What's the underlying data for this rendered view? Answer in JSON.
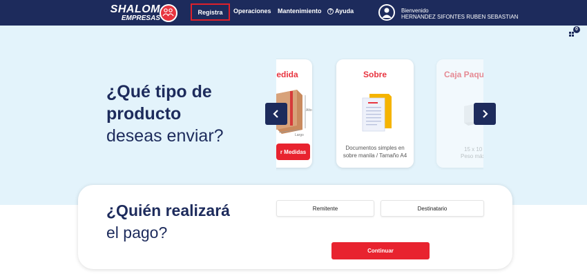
{
  "brand": {
    "name": "SHALOM",
    "sub": "EMPRESAS"
  },
  "nav": {
    "items": [
      {
        "label": "Registra",
        "highlighted": true
      },
      {
        "label": "Operaciones"
      },
      {
        "label": "Mantenimiento"
      },
      {
        "label": "Ayuda",
        "icon": "help-icon"
      }
    ]
  },
  "user": {
    "greeting": "Bienvenido",
    "name": "HERNANDEZ SIFONTES RUBEN SEBASTIAN",
    "icon": "user-icon"
  },
  "cart": {
    "badge": "0",
    "icon": "grid-icon"
  },
  "hero": {
    "line1": "¿Qué tipo de",
    "line2": "producto",
    "line3": "deseas enviar?"
  },
  "carousel": {
    "cards": [
      {
        "title": "Medida",
        "button": "r Medidas",
        "dims": [
          "Alto",
          "Largo"
        ],
        "icon": "box-icon"
      },
      {
        "title": "Sobre",
        "desc": "Documentos simples en sobre manila / Tamaño A4",
        "icon": "envelope-icon"
      },
      {
        "title": "Caja Paqu",
        "desc1": "15 x 10 x",
        "desc2": "Peso máx.",
        "icon": "box-icon"
      }
    ],
    "prev_icon": "chevron-left-icon",
    "next_icon": "chevron-right-icon"
  },
  "payment": {
    "line1": "¿Quién realizará",
    "line2": "el pago?",
    "options": [
      "Remitente",
      "Destinatario"
    ],
    "continue_label": "Continuar"
  },
  "colors": {
    "navy": "#1d2b5c",
    "red": "#e8232f",
    "hero_bg": "#e3f3fb"
  }
}
